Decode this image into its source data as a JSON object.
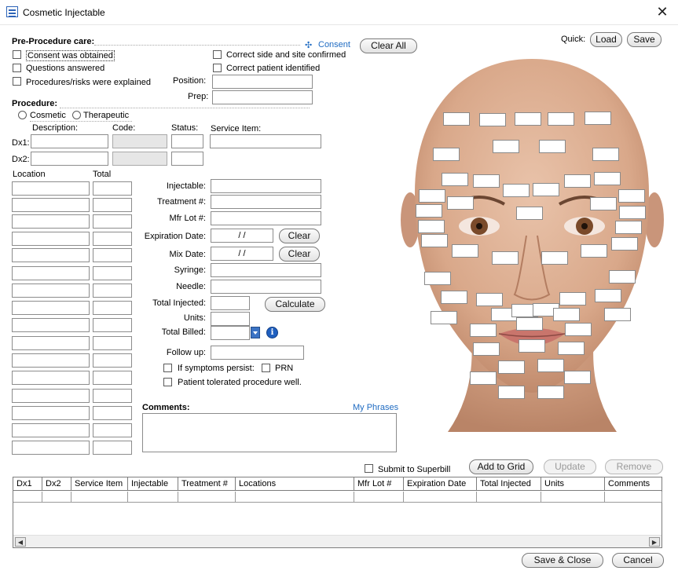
{
  "window": {
    "title": "Cosmetic Injectable",
    "close_glyph": "✕"
  },
  "pre_procedure": {
    "header": "Pre-Procedure care:",
    "consent_link": "Consent",
    "consent_link_icon": "✣",
    "clear_all": "Clear All",
    "checks_left": [
      "Consent was obtained",
      "Questions answered",
      "Procedures/risks were explained"
    ],
    "checks_right": [
      "Correct side and site confirmed",
      "Correct patient identified"
    ],
    "position_label": "Position:",
    "prep_label": "Prep:"
  },
  "quick": {
    "label": "Quick:",
    "load": "Load",
    "save": "Save"
  },
  "procedure": {
    "header": "Procedure:",
    "radios": [
      "Cosmetic",
      "Therapeutic"
    ],
    "desc_label": "Description:",
    "code_label": "Code:",
    "status_label": "Status:",
    "service_item_label": "Service Item:",
    "dx1_label": "Dx1:",
    "dx2_label": "Dx2:"
  },
  "location": {
    "location_label": "Location",
    "total_label": "Total"
  },
  "details": {
    "injectable": "Injectable:",
    "treatment": "Treatment #:",
    "mfr_lot": "Mfr Lot #:",
    "expiration_date": "Expiration Date:",
    "expiration_value": "/ /",
    "mix_date": "Mix Date:",
    "mix_value": "/ /",
    "clear": "Clear",
    "syringe": "Syringe:",
    "needle": "Needle:",
    "total_injected": "Total Injected:",
    "calculate": "Calculate",
    "units": "Units:",
    "total_billed": "Total Billed:",
    "info_glyph": "i",
    "follow_up": "Follow up:",
    "if_symptoms": "If symptoms persist:",
    "prn": "PRN",
    "tolerated": "Patient tolerated procedure well."
  },
  "comments": {
    "label": "Comments:",
    "phrases_link": "My Phrases"
  },
  "actions": {
    "submit_superbill": "Submit to Superbill",
    "add_to_grid": "Add to Grid",
    "update": "Update",
    "remove": "Remove",
    "save_close": "Save & Close",
    "cancel": "Cancel"
  },
  "grid": {
    "columns": [
      "Dx1",
      "Dx2",
      "Service Item",
      "Injectable",
      "Treatment #",
      "Locations",
      "Mfr Lot #",
      "Expiration Date",
      "Total Injected",
      "Units",
      "Comments"
    ]
  }
}
